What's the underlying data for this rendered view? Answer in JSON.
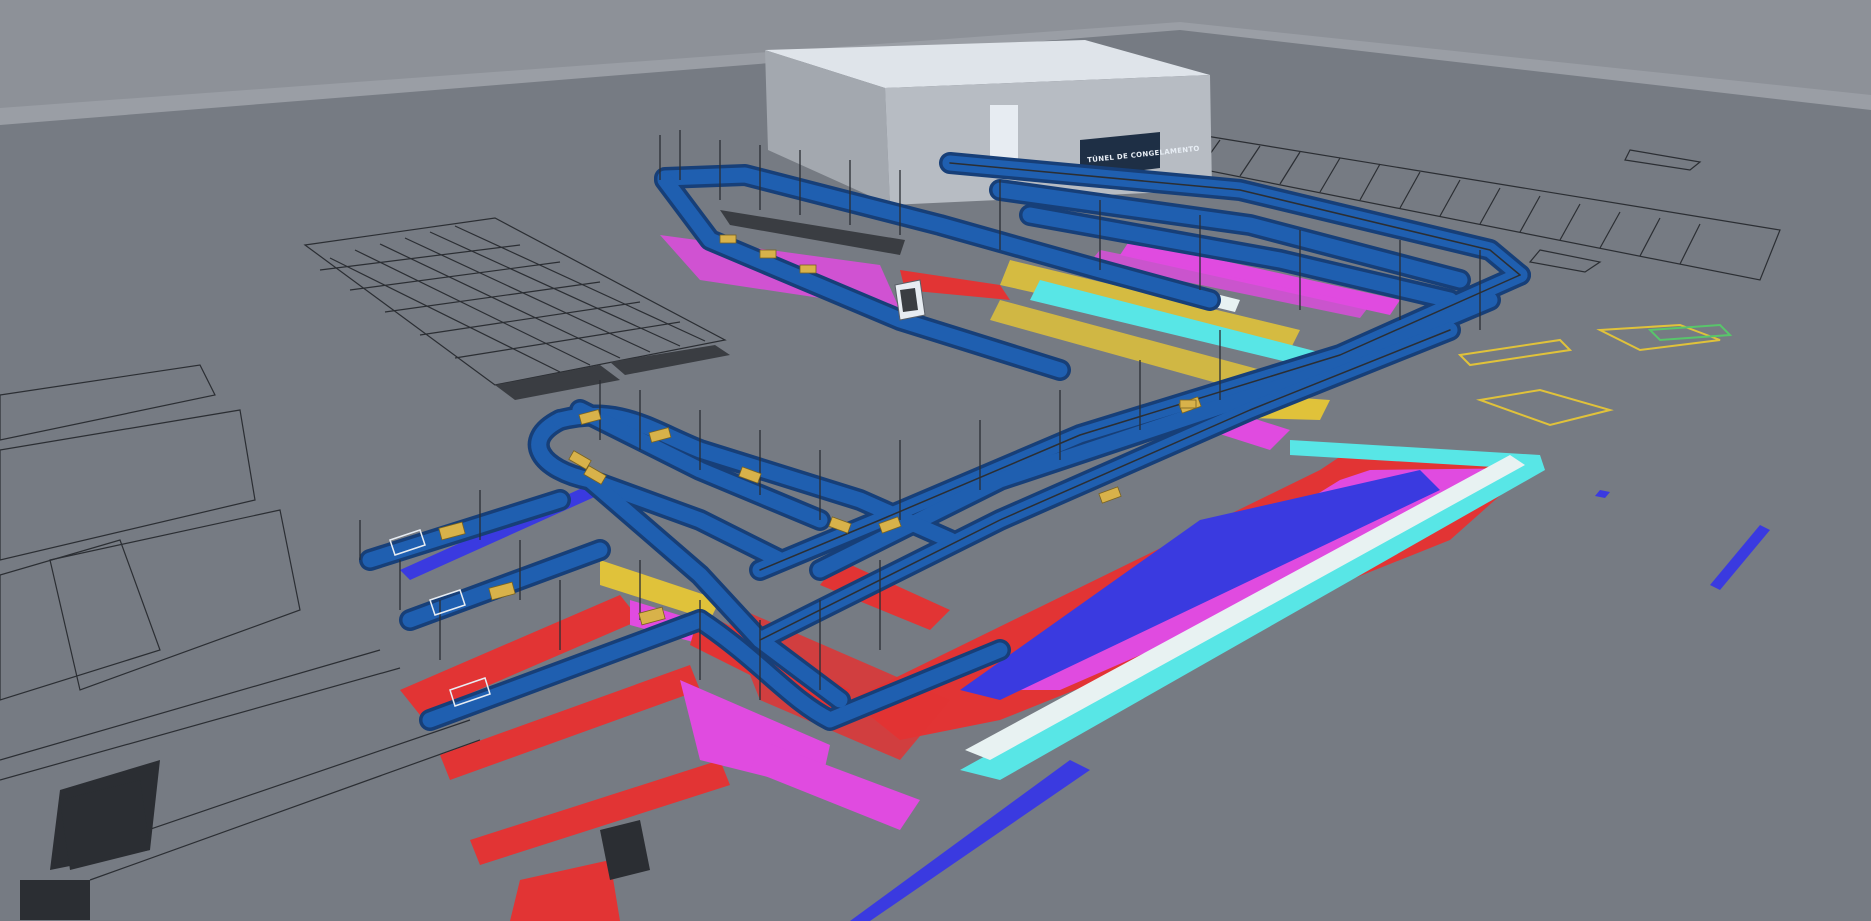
{
  "building": {
    "sign_text": "TÚNEL DE CONGELAMENTO"
  },
  "colors": {
    "background": "#7f848c",
    "floor": "#767b83",
    "floor_far": "#8c9097",
    "building_roof": "#dfe4ea",
    "building_wall": "#b7bcc3",
    "building_side": "#a3a8af",
    "sign": "#1e2f45",
    "conveyor": "#1f5fb0",
    "conveyor_dark": "#173f78",
    "cart": "#d8b24a",
    "cad_red": "#e23434",
    "cad_magenta": "#e04be0",
    "cad_cyan": "#58e6e6",
    "cad_blue": "#3a3ae0",
    "cad_yellow": "#e0c23a",
    "cad_line": "#2b2e33"
  },
  "icons": [
    "freezer-building",
    "conveyor-line",
    "cart-box",
    "floor-plan"
  ]
}
